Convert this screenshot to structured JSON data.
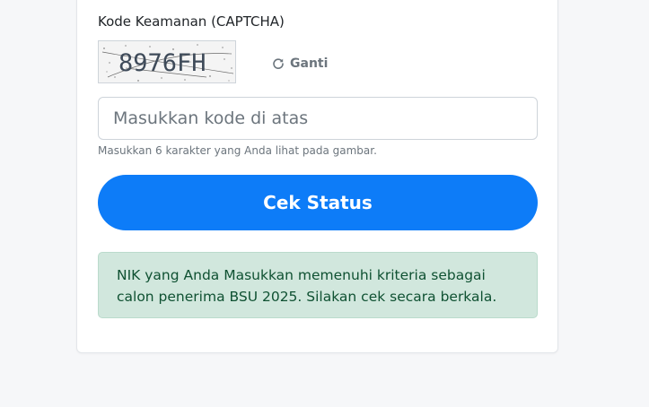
{
  "captcha": {
    "label": "Kode Keamanan (CAPTCHA)",
    "code": "8976FH",
    "refresh_label": "Ganti",
    "refresh_icon": "refresh-icon"
  },
  "code_input": {
    "value": "",
    "placeholder": "Masukkan kode di atas",
    "help": "Masukkan 6 karakter yang Anda lihat pada gambar."
  },
  "submit": {
    "label": "Cek Status",
    "color": "#0d7cf8"
  },
  "result_alert": {
    "message": "NIK yang Anda Masukkan memenuhi kriteria sebagai calon penerima BSU 2025. Silakan cek secara berkala.",
    "color": "#d1e7dd"
  }
}
